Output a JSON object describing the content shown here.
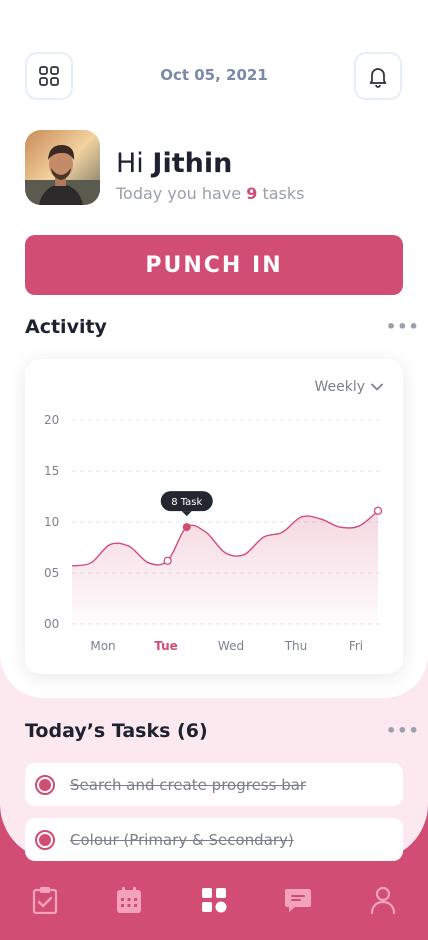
{
  "header": {
    "date": "Oct 05, 2021",
    "menu_icon": "grid-icon",
    "notification_icon": "bell-icon"
  },
  "user": {
    "greeting": "Hi",
    "name": "Jithin",
    "tasks_prefix": "Today you have",
    "task_count": "9",
    "tasks_suffix": "tasks"
  },
  "punch_button": {
    "label": "PUNCH IN"
  },
  "activity": {
    "title": "Activity",
    "more": "•••",
    "period_select": "Weekly"
  },
  "chart_data": {
    "type": "line",
    "title": "",
    "x": [
      "Mon",
      "Tue",
      "Wed",
      "Thu",
      "Fri"
    ],
    "highlighted_x": "Tue",
    "y_ticks": [
      "20",
      "15",
      "10",
      "05",
      "00"
    ],
    "ylim": [
      0,
      20
    ],
    "grid": true,
    "series": [
      {
        "values": [
          5.7,
          6.0,
          7.8,
          7.6,
          6.0,
          6.2,
          9.5,
          9.0,
          7.0,
          6.8,
          8.5,
          9.0,
          10.5,
          10.3,
          9.5,
          9.6,
          11.1
        ]
      }
    ],
    "tooltip": {
      "label": "8 Task"
    },
    "colors": {
      "line": "#d24d74",
      "grid": "#e1e5ec"
    }
  },
  "tasks": {
    "title": "Today’s Tasks (6)",
    "more": "•••",
    "items": [
      {
        "label": "Search and create progress bar",
        "done": true
      },
      {
        "label": "Colour (Primary & Secondary)",
        "done": true
      }
    ]
  },
  "nav": {
    "items": [
      {
        "icon": "clipboard-check-icon",
        "active": false
      },
      {
        "icon": "calendar-icon",
        "active": false
      },
      {
        "icon": "dashboard-icon",
        "active": true
      },
      {
        "icon": "chat-icon",
        "active": false
      },
      {
        "icon": "profile-icon",
        "active": false
      }
    ]
  },
  "colors": {
    "accent": "#d24d74",
    "tint": "#fbe9ef",
    "text": "#1e2230"
  }
}
